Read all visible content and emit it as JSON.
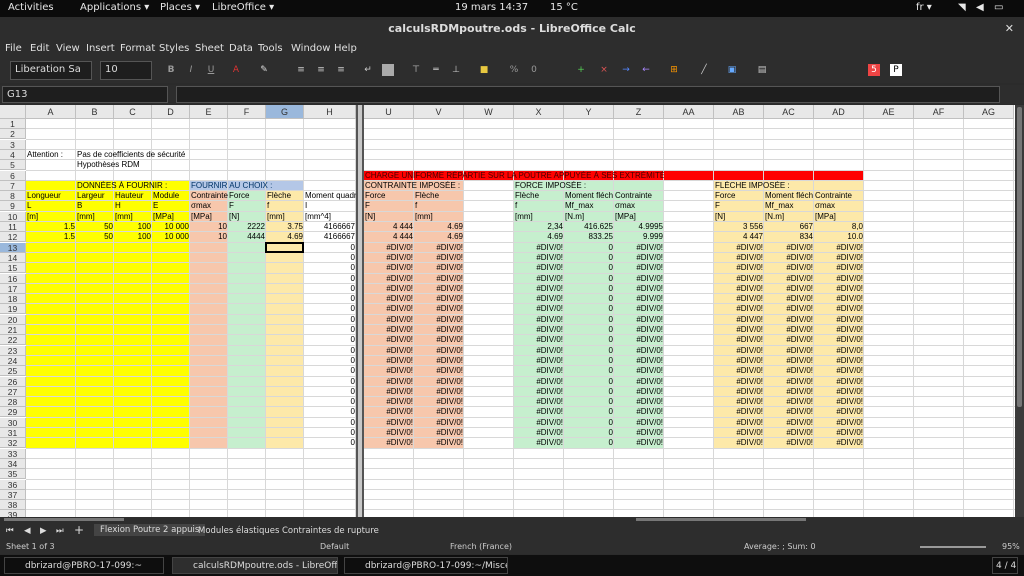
{
  "topbar": {
    "activities": "Activities",
    "applications": "Applications ▾",
    "places": "Places ▾",
    "app": "LibreOffice ▾",
    "datetime": "19 mars  14:37",
    "weather": "15 °C",
    "lang": "fr ▾"
  },
  "window": {
    "title": "calculsRDMpoutre.ods - LibreOffice Calc",
    "close": "✕"
  },
  "menu": [
    "File",
    "Edit",
    "View",
    "Insert",
    "Format",
    "Styles",
    "Sheet",
    "Data",
    "Tools",
    "Window",
    "Help"
  ],
  "toolbar": {
    "font_name": "Liberation Sa",
    "font_size": "10"
  },
  "namebox": "G13",
  "columns": [
    "A",
    "B",
    "C",
    "D",
    "E",
    "F",
    "G",
    "H",
    "",
    "U",
    "V",
    "W",
    "X",
    "Y",
    "Z",
    "AA",
    "AB",
    "AC",
    "AD",
    "AE",
    "AF",
    "AG"
  ],
  "rows": [
    "1",
    "2",
    "3",
    "4",
    "5",
    "6",
    "7",
    "8",
    "9",
    "10",
    "11",
    "12",
    "13",
    "14",
    "15",
    "16",
    "17",
    "18",
    "19",
    "20",
    "21",
    "22",
    "23",
    "24",
    "25",
    "26",
    "27",
    "28",
    "29",
    "30",
    "31",
    "32",
    "33",
    "34",
    "35",
    "36",
    "37",
    "38",
    "39"
  ],
  "cells": {
    "A4": "Attention :",
    "B4": "Pas de coefficients de sécurité",
    "B5": "Hypothèses RDM",
    "U6": "CHARGE UNIFORME RÉPARTIE SUR LA POUTRE APPUYÉE À SES EXTRÉMITÉS",
    "B7": "DONNÉES À FOURNIR :",
    "E7": "FOURNIR AU CHOIX :",
    "U7": "CONTRAINTE IMPOSÉE :",
    "X7": "FORCE IMPOSÉE :",
    "AB7": "FLÈCHE IMPOSÉE :",
    "A8": "Longueur",
    "B8": "Largeur",
    "C8": "Hauteur",
    "D8": "Module",
    "E8": "Contrainte",
    "F8": "Force",
    "G8": "Flèche",
    "H8": "Moment quadra",
    "U8": "Force",
    "V8": "Flèche",
    "X8": "Flèche",
    "Y8": "Moment fléch",
    "Z8": "Contrainte",
    "AB8": "Force",
    "AC8": "Moment fléch",
    "AD8": "Contrainte",
    "A9": "L",
    "B9": "B",
    "C9": "H",
    "D9": "E",
    "E9": "σmax",
    "F9": "F",
    "G9": "f",
    "H9": "I",
    "U9": "F",
    "V9": "f",
    "X9": "f",
    "Y9": "Mf_max",
    "Z9": "σmax",
    "AB9": "F",
    "AC9": "Mf_max",
    "AD9": "σmax",
    "A10": "[m]",
    "B10": "[mm]",
    "C10": "[mm]",
    "D10": "[MPa]",
    "E10": "[MPa]",
    "F10": "[N]",
    "G10": "[mm]",
    "H10": "[mm^4]",
    "U10": "[N]",
    "V10": "[mm]",
    "X10": "[mm]",
    "Y10": "[N.m]",
    "Z10": "[MPa]",
    "AB10": "[N]",
    "AC10": "[N.m]",
    "AD10": "[MPa]",
    "A11": "1.5",
    "B11": "50",
    "C11": "100",
    "D11": "10 000",
    "E11": "10",
    "F11": "2222",
    "G11": "3.75",
    "H11": "4166667",
    "U11": "4 444",
    "V11": "4.69",
    "X11": "2,34",
    "Y11": "416.625",
    "Z11": "4.9995",
    "AB11": "3 556",
    "AC11": "667",
    "AD11": "8,0",
    "A12": "1.5",
    "B12": "50",
    "C12": "100",
    "D12": "10 000",
    "E12": "10",
    "F12": "4444",
    "G12": "4.69",
    "H12": "4166667",
    "U12": "4 444",
    "V12": "4.69",
    "X12": "4.69",
    "Y12": "833.25",
    "Z12": "9.999",
    "AB12": "4 447",
    "AC12": "834",
    "AD12": "10.0"
  },
  "fill": {
    "h": "0",
    "uvz": "#DIV/0!",
    "y": "0"
  },
  "tabs": [
    "Flexion Poutre 2 appuis",
    "Modules élastiques",
    "Contraintes de rupture"
  ],
  "status": {
    "sheet": "Sheet 1 of 3",
    "style": "Default",
    "lang": "French (France)",
    "sum": "Average: ; Sum: 0",
    "zoom": "95%"
  },
  "taskbar": [
    "dbrizard@PBRO-17-099:~",
    "calculsRDMpoutre.ods - LibreOffic...",
    "dbrizard@PBRO-17-099:~/Miscell...",
    "4 / 4"
  ],
  "colors": {
    "yellow": "#ffff00",
    "blue": "#b4c7e7",
    "pink": "#f7c7ac",
    "green": "#c6efce",
    "peach": "#fde9a9",
    "red": "#ff0000"
  }
}
